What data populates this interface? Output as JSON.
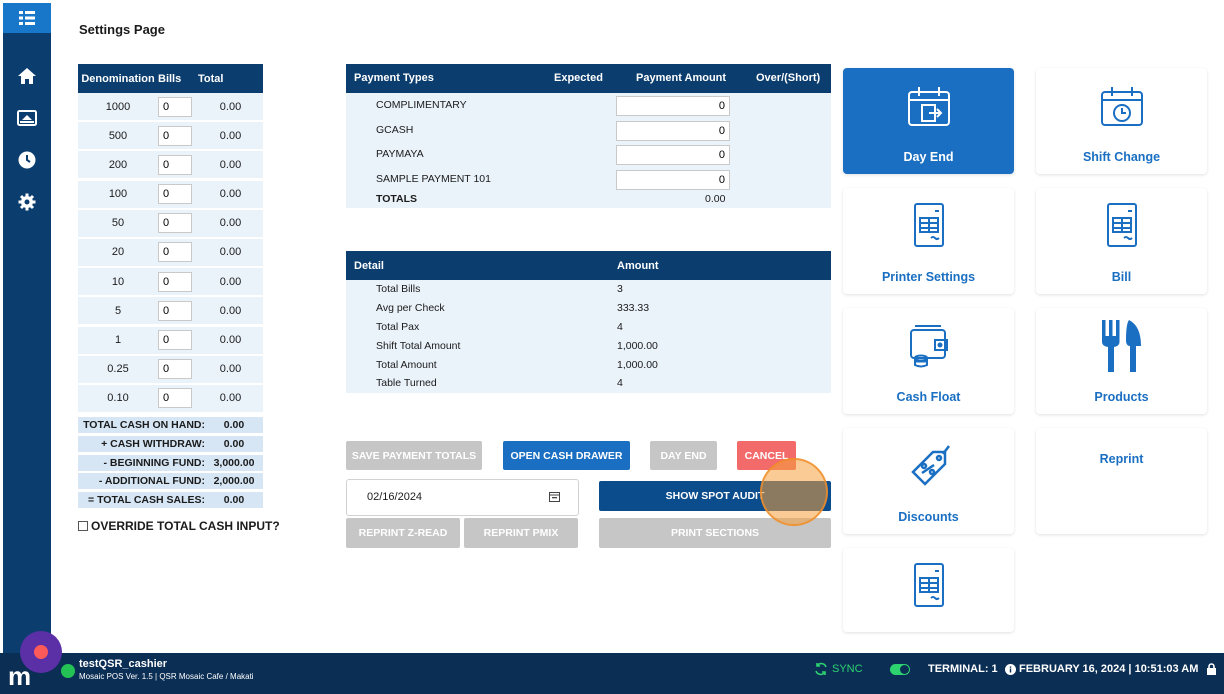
{
  "page": {
    "title": "Settings Page"
  },
  "denom_table": {
    "headers": [
      "Denomination",
      "Bills",
      "Total"
    ],
    "rows": [
      {
        "denom": "1000",
        "bills": "0",
        "total": "0.00"
      },
      {
        "denom": "500",
        "bills": "0",
        "total": "0.00"
      },
      {
        "denom": "200",
        "bills": "0",
        "total": "0.00"
      },
      {
        "denom": "100",
        "bills": "0",
        "total": "0.00"
      },
      {
        "denom": "50",
        "bills": "0",
        "total": "0.00"
      },
      {
        "denom": "20",
        "bills": "0",
        "total": "0.00"
      },
      {
        "denom": "10",
        "bills": "0",
        "total": "0.00"
      },
      {
        "denom": "5",
        "bills": "0",
        "total": "0.00"
      },
      {
        "denom": "1",
        "bills": "0",
        "total": "0.00"
      },
      {
        "denom": "0.25",
        "bills": "0",
        "total": "0.00"
      },
      {
        "denom": "0.10",
        "bills": "0",
        "total": "0.00"
      }
    ],
    "summary": [
      {
        "label": "TOTAL CASH ON HAND:",
        "value": "0.00"
      },
      {
        "label": "+ CASH WITHDRAW:",
        "value": "0.00"
      },
      {
        "label": "- BEGINNING FUND:",
        "value": "3,000.00"
      },
      {
        "label": "- ADDITIONAL FUND:",
        "value": "2,000.00"
      },
      {
        "label": "= TOTAL CASH SALES:",
        "value": "0.00"
      }
    ],
    "override_label": "OVERRIDE TOTAL CASH INPUT?"
  },
  "payment_table": {
    "headers": [
      "Payment Types",
      "Expected",
      "Payment Amount",
      "Over/(Short)"
    ],
    "rows": [
      {
        "type": "COMPLIMENTARY",
        "amount": "0"
      },
      {
        "type": "GCASH",
        "amount": "0"
      },
      {
        "type": "PAYMAYA",
        "amount": "0"
      },
      {
        "type": "SAMPLE PAYMENT 101",
        "amount": "0"
      }
    ],
    "totals_label": "TOTALS",
    "totals_value": "0.00"
  },
  "detail_table": {
    "headers": [
      "Detail",
      "Amount"
    ],
    "rows": [
      {
        "label": "Total Bills",
        "value": "3"
      },
      {
        "label": "Avg per Check",
        "value": "333.33"
      },
      {
        "label": "Total Pax",
        "value": "4"
      },
      {
        "label": "Shift Total Amount",
        "value": "1,000.00"
      },
      {
        "label": "Total Amount",
        "value": "1,000.00"
      },
      {
        "label": "Table Turned",
        "value": "4"
      }
    ]
  },
  "actions": {
    "save_payment_totals": "SAVE PAYMENT TOTALS",
    "open_cash_drawer": "OPEN CASH DRAWER",
    "day_end": "DAY END",
    "cancel": "CANCEL",
    "date_value": "02/16/2024",
    "show_spot_audit": "SHOW SPOT AUDIT",
    "reprint_zread": "REPRINT Z-READ",
    "reprint_pmix": "REPRINT PMIX",
    "print_sections": "PRINT SECTIONS"
  },
  "tiles": {
    "day_end": "Day End",
    "shift_change": "Shift Change",
    "printer_settings": "Printer Settings",
    "bill": "Bill",
    "cash_float": "Cash Float",
    "products": "Products",
    "discounts": "Discounts",
    "reprint": "Reprint"
  },
  "footer": {
    "logo": "m",
    "username": "testQSR_cashier",
    "version": "Mosaic POS Ver. 1.5 | QSR Mosaic Cafe / Makati",
    "sync": "SYNC",
    "terminal": "TERMINAL: 1",
    "datetime": "FEBRUARY 16, 2024 | 10:51:03 AM"
  },
  "colors": {
    "navy": "#0b3d6e",
    "accent_blue": "#1a6fc2",
    "cancel_red": "#f26a6a",
    "disabled_gray": "#c6c6c6",
    "sync_green": "#2dd36f"
  }
}
